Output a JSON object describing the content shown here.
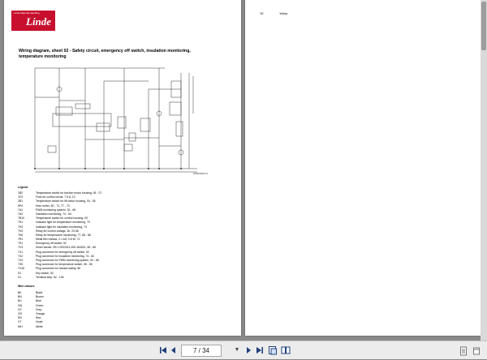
{
  "viewer": {
    "page_current": "7",
    "page_separator": "/",
    "page_total": "34",
    "page_box_text": "7 / 34"
  },
  "left_page": {
    "logo": {
      "tagline": "Linde Material Handling",
      "brand": "Linde"
    },
    "title": "Wiring diagram, sheet 02 - Safety circuit, emergency off switch, insulation monitoring, temperature monitoring",
    "diagram_code": "0000000000 01",
    "legend_heading": "Legend",
    "legend": [
      {
        "code": "1B2",
        "desc": "Temperature switch for traction motor housing, 06 - 07"
      },
      {
        "code": "1F3",
        "desc": "Fuse for control circuit, 7.5 A, 12"
      },
      {
        "code": "2B1",
        "desc": "Temperature switch for lift motor housing, 04 - 05"
      },
      {
        "code": "6P4",
        "desc": "Hour meter, 50 - 71, 77 - 73"
      },
      {
        "code": "7A1",
        "desc": "PWM monitoring system, 32 - 66"
      },
      {
        "code": "7A2",
        "desc": "Insulation monitoring, 74 - 64"
      },
      {
        "code": "7B10",
        "desc": "Temperature switch for control housing, 09"
      },
      {
        "code": "7H1",
        "desc": "Indicator light for temperature monitoring, 70"
      },
      {
        "code": "7H2",
        "desc": "Indicator light for insulation monitoring, 74"
      },
      {
        "code": "7K3",
        "desc": "Relay for control voltage, 2b, 23 66"
      },
      {
        "code": "7K6",
        "desc": "Relay for temperature monitoring, 77, 68 - 68"
      },
      {
        "code": "7R1",
        "desc": "Metal film resistor, 2.1 kΩ, 0.6 W, 71"
      },
      {
        "code": "7S1",
        "desc": "Emergency off switch, 52"
      },
      {
        "code": "7V3",
        "desc": "Zener barrier, ZB 1 0002011-200-164001, 65 - 66"
      },
      {
        "code": "7X1",
        "desc": "Plug connector for emergency off switch, 52"
      },
      {
        "code": "7X2",
        "desc": "Plug connector for insulation monitoring, 74 - 64"
      },
      {
        "code": "7X3",
        "desc": "Plug connector for PWM monitoring system, 52 - 68"
      },
      {
        "code": "7X5",
        "desc": "Plug connector for temperature switch, 08 - 36"
      },
      {
        "code": "7X16",
        "desc": "Plug connector for release safety, 56"
      },
      {
        "code": "S1",
        "desc": "Key switch, 52"
      },
      {
        "code": "X1",
        "desc": "Terminal strip, 52 - 146"
      }
    ],
    "wire_heading": "Wire colours",
    "wire_colours": [
      {
        "code": "BK",
        "desc": "Black"
      },
      {
        "code": "BN",
        "desc": "Brown"
      },
      {
        "code": "BU",
        "desc": "Blue"
      },
      {
        "code": "GN",
        "desc": "Green"
      },
      {
        "code": "GY",
        "desc": "Grey"
      },
      {
        "code": "OG",
        "desc": "Orange"
      },
      {
        "code": "RD",
        "desc": "Red"
      },
      {
        "code": "VT",
        "desc": "Violet"
      },
      {
        "code": "WH",
        "desc": "White"
      }
    ]
  },
  "right_page": {
    "rows": [
      {
        "code": "YE",
        "desc": "Yellow"
      }
    ]
  },
  "colors": {
    "viewer_bg": "#8a8a8a",
    "logo_red": "#c8102e",
    "toolbar_icon": "#1f3f7a"
  }
}
